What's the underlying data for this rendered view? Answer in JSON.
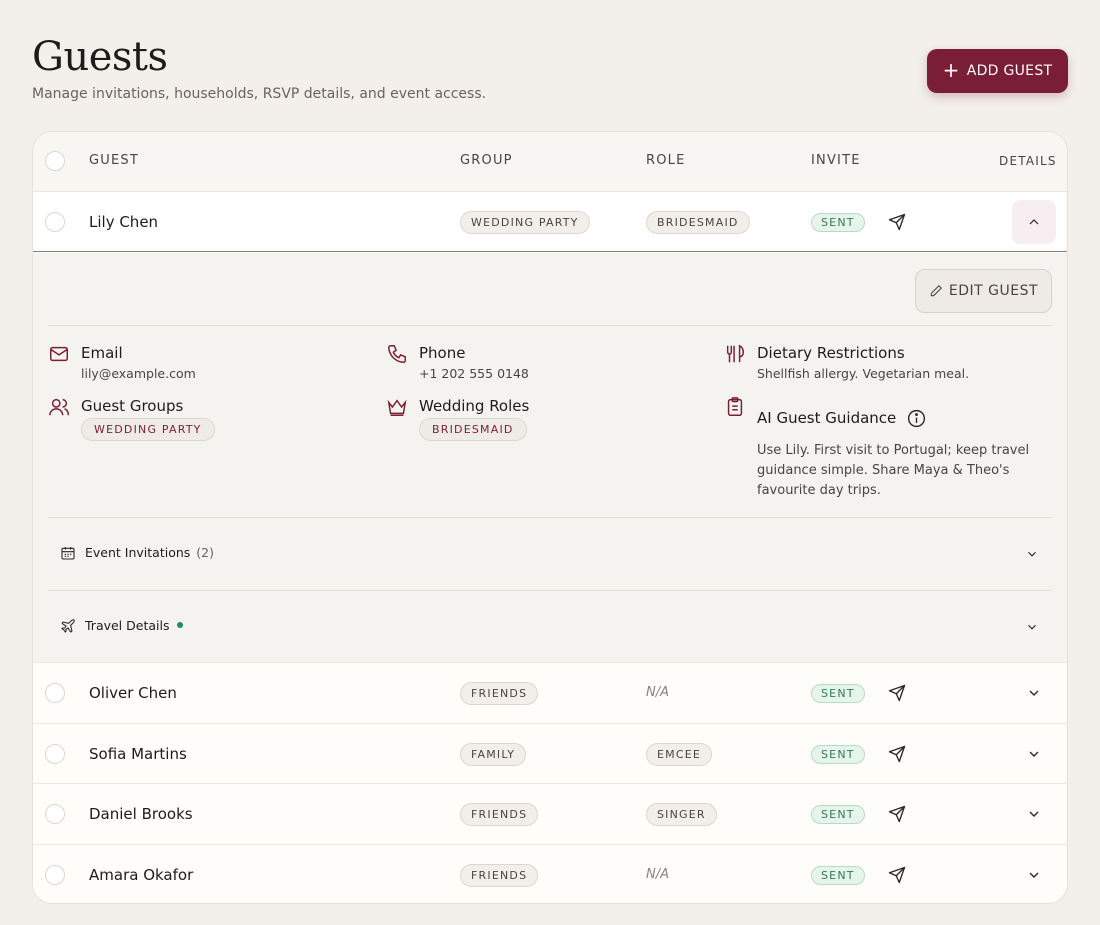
{
  "page": {
    "title": "Guests",
    "subtitle": "Manage invitations, households, RSVP details, and event access.",
    "add_button": "ADD GUEST"
  },
  "table": {
    "headers": {
      "guest": "GUEST",
      "group": "GROUP",
      "role": "ROLE",
      "invite": "INVITE",
      "details": "DETAILS"
    },
    "rows": [
      {
        "name": "Lily Chen",
        "group": "WEDDING PARTY",
        "role": "BRIDESMAID",
        "invite": "SENT",
        "expanded": true
      },
      {
        "name": "Oliver Chen",
        "group": "FRIENDS",
        "role": "N/A",
        "invite": "SENT"
      },
      {
        "name": "Sofia Martins",
        "group": "FAMILY",
        "role": "EMCEE",
        "invite": "SENT"
      },
      {
        "name": "Daniel Brooks",
        "group": "FRIENDS",
        "role": "SINGER",
        "invite": "SENT"
      },
      {
        "name": "Amara Okafor",
        "group": "FRIENDS",
        "role": "N/A",
        "invite": "SENT"
      }
    ]
  },
  "detail": {
    "edit_button": "EDIT GUEST",
    "email": {
      "label": "Email",
      "value": "lily@example.com"
    },
    "phone": {
      "label": "Phone",
      "value": "+1 202 555 0148"
    },
    "dietary": {
      "label": "Dietary Restrictions",
      "value": "Shellfish allergy. Vegetarian meal."
    },
    "groups": {
      "label": "Guest Groups",
      "value": "WEDDING PARTY"
    },
    "roles": {
      "label": "Wedding Roles",
      "value": "BRIDESMAID"
    },
    "guidance": {
      "label": "AI Guest Guidance",
      "value": "Use Lily. First visit to Portugal; keep travel guidance simple. Share Maya & Theo's favourite day trips."
    },
    "event_invitations": {
      "label": "Event Invitations",
      "count": "(2)"
    },
    "travel": {
      "label": "Travel Details"
    }
  },
  "colors": {
    "brand": "#7a1d36",
    "sent_bg": "#e6f4ec",
    "sent_text": "#2d7d50",
    "status_dot": "#1f8a5a"
  }
}
